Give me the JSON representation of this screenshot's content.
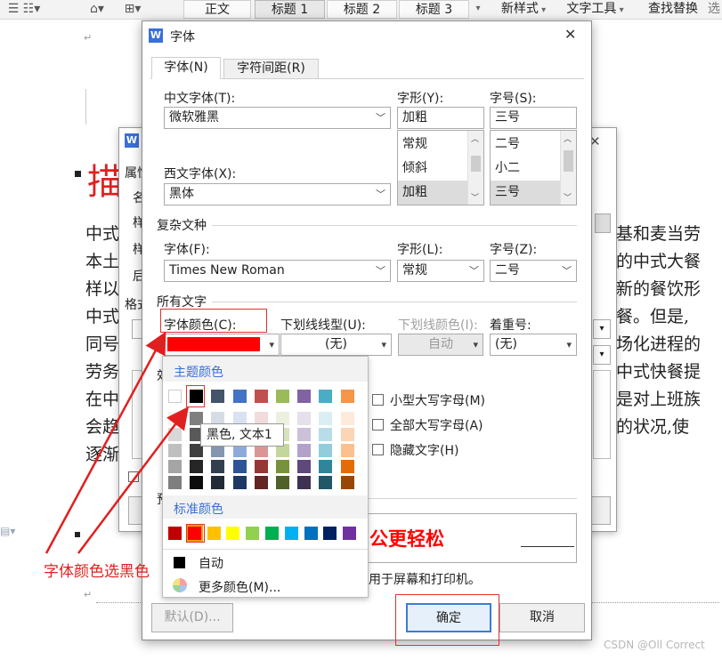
{
  "ribbon": {
    "styles": [
      "正文",
      "标题 1",
      "标题 2",
      "标题 3"
    ],
    "new_style": "新样式",
    "text_tools": "文字工具",
    "find_replace": "查找替换",
    "more": "选"
  },
  "document": {
    "title_char": "描",
    "para_right": [
      "基和麦当劳",
      "的中式大餐",
      "新的餐饮形",
      "餐。但是,",
      "场化进程的",
      "中式快餐提",
      "是对上班族",
      "的状况,使"
    ],
    "para_left": [
      "中式",
      "本土",
      "样以",
      "中式",
      "同号",
      "劳务",
      "在中",
      "会趋",
      "逐渐"
    ],
    "banner_text": "公更轻松"
  },
  "back_dialog": {
    "left_labels": [
      "属性",
      "名",
      "样",
      "样",
      "后",
      "格式"
    ]
  },
  "dialog": {
    "title": "字体",
    "close": "✕",
    "tabs": [
      "字体(N)",
      "字符间距(R)"
    ],
    "cn_font_label": "中文字体(T):",
    "cn_font_value": "微软雅黑",
    "style_label": "字形(Y):",
    "style_value": "加粗",
    "style_list": [
      "常规",
      "倾斜",
      "加粗"
    ],
    "size_label": "字号(S):",
    "size_value": "三号",
    "size_list": [
      "二号",
      "小二",
      "三号"
    ],
    "west_font_label": "西文字体(X):",
    "west_font_value": "黑体",
    "complex_section": "复杂文种",
    "complex_font_label": "字体(F):",
    "complex_font_value": "Times New Roman",
    "complex_style_label": "字形(L):",
    "complex_style_value": "常规",
    "complex_size_label": "字号(Z):",
    "complex_size_value": "二号",
    "all_text_section": "所有文字",
    "font_color_label": "字体颜色(C):",
    "underline_label": "下划线线型(U):",
    "underline_value": "(无)",
    "underline_color_label": "下划线颜色(I):",
    "underline_color_value": "自动",
    "emphasis_label": "着重号:",
    "emphasis_value": "(无)",
    "effects_partial": "效",
    "preview_partial": "预",
    "effects": [
      "小型大写字母(M)",
      "全部大写字母(A)",
      "隐藏文字(H)"
    ],
    "preview_note": "用于屏幕和打印机。",
    "default_button": "默认(D)...",
    "ok_button": "确定",
    "cancel_button": "取消"
  },
  "color_popup": {
    "theme_header": "主题颜色",
    "tooltip": "黑色, 文本1",
    "standard_header": "标准颜色",
    "auto_label": "自动",
    "more_colors_label": "更多颜色(M)...",
    "theme_top_row": [
      "#ffffff",
      "#000000",
      "#44546a",
      "#4472c4",
      "#c0504d",
      "#9bbb59",
      "#8064a2",
      "#4bacc6",
      "#f79646"
    ],
    "theme_shades": [
      [
        "#f2f2f2",
        "#7f7f7f",
        "#d6dce4",
        "#d9e2f3",
        "#f2dcdb",
        "#ebf1dd",
        "#e5e0ec",
        "#dbeef3",
        "#fdeada"
      ],
      [
        "#d8d8d8",
        "#595959",
        "#adb9ca",
        "#b4c6e7",
        "#e5b9b7",
        "#d7e3bc",
        "#ccc1d9",
        "#b7dde8",
        "#fbd5b5"
      ],
      [
        "#bfbfbf",
        "#3f3f3f",
        "#8496b0",
        "#8eaadb",
        "#d99694",
        "#c3d69b",
        "#b2a2c7",
        "#92cddc",
        "#fac08f"
      ],
      [
        "#a5a5a5",
        "#262626",
        "#333f4f",
        "#2f5496",
        "#953734",
        "#76923c",
        "#5f497a",
        "#31859b",
        "#e36c09"
      ],
      [
        "#7f7f7f",
        "#0c0c0c",
        "#222a35",
        "#1f3864",
        "#632423",
        "#4f6128",
        "#3f3151",
        "#205867",
        "#974806"
      ]
    ],
    "standard_colors": [
      "#c00000",
      "#ff0000",
      "#ffc000",
      "#ffff00",
      "#92d050",
      "#00b050",
      "#00b0f0",
      "#0070c0",
      "#002060",
      "#7030a0"
    ],
    "selected_color": "#ff0000"
  },
  "annotation": {
    "text": "字体颜色选黑色",
    "color": "#e02020"
  },
  "watermark": "CSDN @Oll Correct"
}
